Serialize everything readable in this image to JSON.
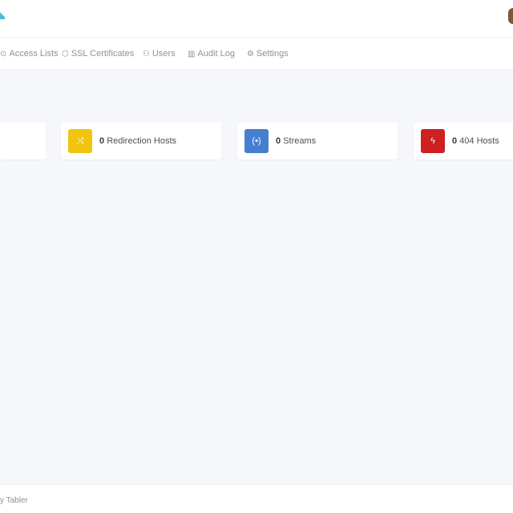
{
  "nav": {
    "items": [
      {
        "label": "Access Lists",
        "icon": "lock-icon"
      },
      {
        "label": "SSL Certificates",
        "icon": "shield-icon"
      },
      {
        "label": "Users",
        "icon": "users-icon"
      },
      {
        "label": "Audit Log",
        "icon": "book-icon"
      },
      {
        "label": "Settings",
        "icon": "settings-icon"
      }
    ]
  },
  "cards": [
    {
      "count": "0",
      "label": "Redirection Hosts",
      "color": "#f1c40f",
      "icon": "shuffle-icon"
    },
    {
      "count": "0",
      "label": "Streams",
      "color": "#467fcf",
      "icon": "radio-icon"
    },
    {
      "count": "0",
      "label": "404 Hosts",
      "color": "#cd201f",
      "icon": "zap-off-icon"
    }
  ],
  "footer": {
    "text": "y Tabler"
  }
}
